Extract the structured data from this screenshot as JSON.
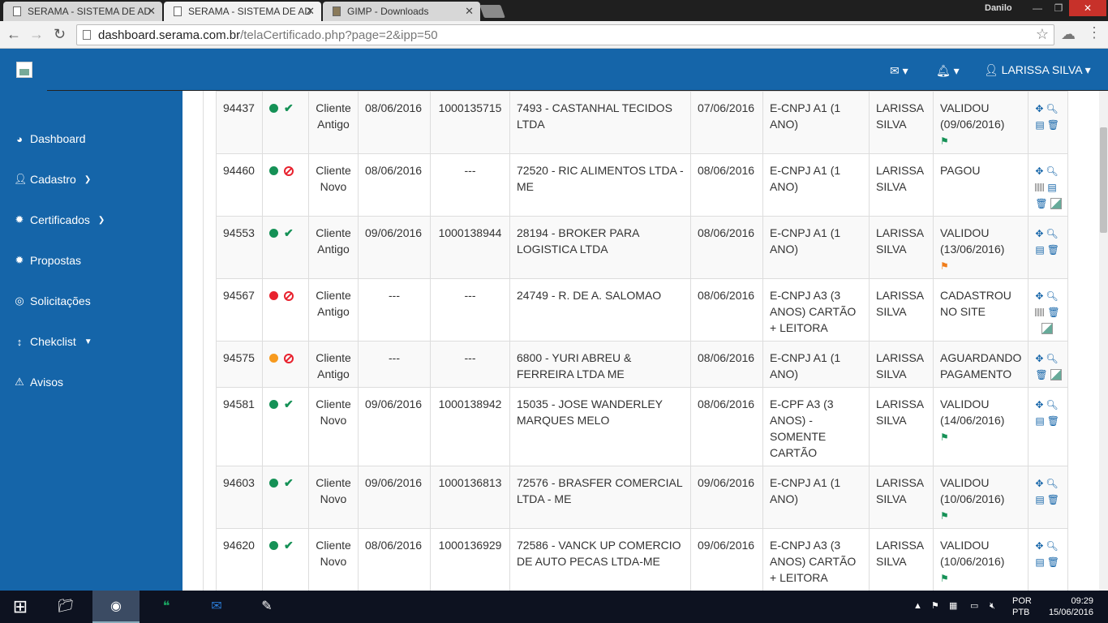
{
  "browser": {
    "tabs": [
      {
        "label": "SERAMA - SISTEMA DE AD"
      },
      {
        "label": "SERAMA - SISTEMA DE AD"
      },
      {
        "label": "GIMP - Downloads"
      }
    ],
    "os_user": "Danilo",
    "url_host": "dashboard.serama.com.br",
    "url_rest": "/telaCertificado.php?page=2&ipp=50"
  },
  "topbar": {
    "user": "LARISSA SILVA",
    "mail_icon": "envelope-icon",
    "bell_icon": "bell-icon"
  },
  "sidebar": {
    "items": [
      {
        "label": "Dashboard",
        "icon": "dashboard-icon"
      },
      {
        "label": "Cadastro",
        "icon": "user-add-icon"
      },
      {
        "label": "Certificados",
        "icon": "gear-icon"
      },
      {
        "label": "Propostas",
        "icon": "gear-icon"
      },
      {
        "label": "Solicitações",
        "icon": "lifebuoy-icon"
      },
      {
        "label": "Chekclist",
        "icon": "arrows-vertical-icon"
      },
      {
        "label": "Avisos",
        "icon": "warning-icon"
      }
    ]
  },
  "table": {
    "rows": [
      {
        "id": "94437",
        "dot": "#159156",
        "mark": "check",
        "client": "Cliente Antigo",
        "date1": "08/06/2016",
        "protocol": "1000135715",
        "company": "7493 - CASTANHAL TECIDOS LTDA",
        "date2": "07/06/2016",
        "type": "E-CNPJ A1 (1 ANO)",
        "user": "LARISSA SILVA",
        "status": "VALIDOU (09/06/2016)",
        "flag": "#159156"
      },
      {
        "id": "94460",
        "dot": "#159156",
        "mark": "block",
        "client": "Cliente Novo",
        "date1": "08/06/2016",
        "protocol": "---",
        "company": "72520 - RIC ALIMENTOS LTDA - ME",
        "date2": "08/06/2016",
        "type": "E-CNPJ A1 (1 ANO)",
        "user": "LARISSA SILVA",
        "status": "PAGOU",
        "flag": ""
      },
      {
        "id": "94553",
        "dot": "#159156",
        "mark": "check",
        "client": "Cliente Antigo",
        "date1": "09/06/2016",
        "protocol": "1000138944",
        "company": "28194 - BROKER PARA LOGISTICA LTDA",
        "date2": "08/06/2016",
        "type": "E-CNPJ A1 (1 ANO)",
        "user": "LARISSA SILVA",
        "status": "VALIDOU (13/06/2016)",
        "flag": "#f07d1a"
      },
      {
        "id": "94567",
        "dot": "#e8222e",
        "mark": "block",
        "client": "Cliente Antigo",
        "date1": "---",
        "protocol": "---",
        "company": "24749 - R. DE A. SALOMAO",
        "date2": "08/06/2016",
        "type": "E-CNPJ A3 (3 ANOS) CARTÃO + LEITORA",
        "user": "LARISSA SILVA",
        "status": "CADASTROU NO SITE",
        "flag": ""
      },
      {
        "id": "94575",
        "dot": "#f79a1e",
        "mark": "block",
        "client": "Cliente Antigo",
        "date1": "---",
        "protocol": "---",
        "company": "6800 - YURI ABREU & FERREIRA LTDA ME",
        "date2": "08/06/2016",
        "type": "E-CNPJ A1 (1 ANO)",
        "user": "LARISSA SILVA",
        "status": "AGUARDANDO PAGAMENTO",
        "flag": ""
      },
      {
        "id": "94581",
        "dot": "#159156",
        "mark": "check",
        "client": "Cliente Novo",
        "date1": "09/06/2016",
        "protocol": "1000138942",
        "company": "15035 - JOSE WANDERLEY MARQUES MELO",
        "date2": "08/06/2016",
        "type": "E-CPF A3 (3 ANOS) - SOMENTE CARTÃO",
        "user": "LARISSA SILVA",
        "status": "VALIDOU (14/06/2016)",
        "flag": "#159156"
      },
      {
        "id": "94603",
        "dot": "#159156",
        "mark": "check",
        "client": "Cliente Novo",
        "date1": "09/06/2016",
        "protocol": "1000136813",
        "company": "72576 - BRASFER COMERCIAL LTDA - ME",
        "date2": "09/06/2016",
        "type": "E-CNPJ A1 (1 ANO)",
        "user": "LARISSA SILVA",
        "status": "VALIDOU (10/06/2016)",
        "flag": "#159156"
      },
      {
        "id": "94620",
        "dot": "#159156",
        "mark": "check",
        "client": "Cliente Novo",
        "date1": "08/06/2016",
        "protocol": "1000136929",
        "company": "72586 - VANCK UP COMERCIO DE AUTO PECAS LTDA-ME",
        "date2": "09/06/2016",
        "type": "E-CNPJ A3 (3 ANOS) CARTÃO + LEITORA",
        "user": "LARISSA SILVA",
        "status": "VALIDOU (10/06/2016)",
        "flag": "#159156"
      }
    ]
  },
  "taskbar": {
    "lang1": "POR",
    "lang2": "PTB",
    "time": "09:29",
    "date": "15/06/2016"
  }
}
